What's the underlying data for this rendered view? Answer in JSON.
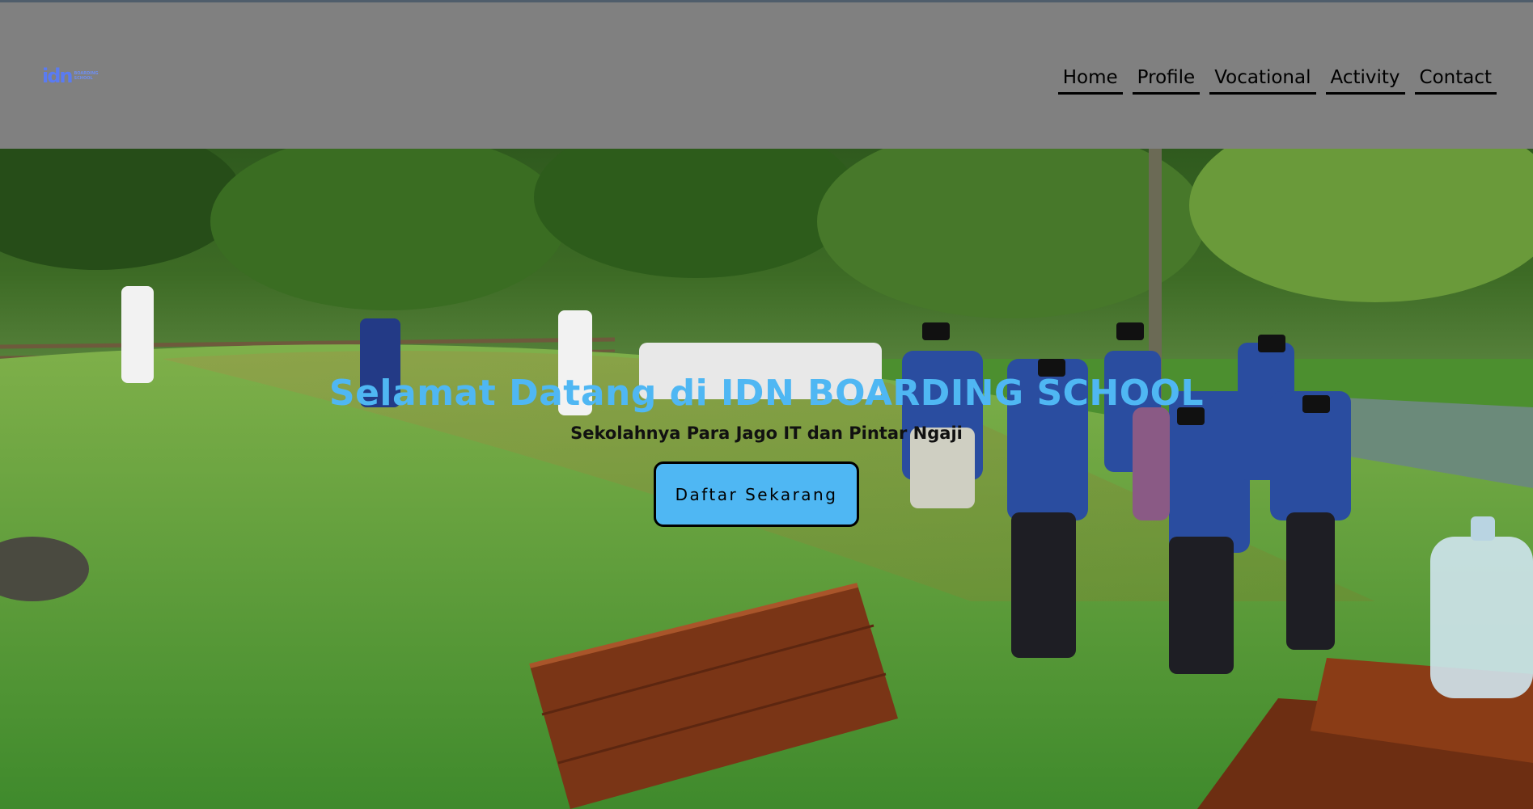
{
  "logo": {
    "mark": "idn",
    "sub_line1": "BOARDING",
    "sub_line2": "SCHOOL",
    "color": "#5a7bf2"
  },
  "nav": {
    "items": [
      {
        "label": "Home"
      },
      {
        "label": "Profile"
      },
      {
        "label": "Vocational"
      },
      {
        "label": "Activity"
      },
      {
        "label": "Contact"
      }
    ]
  },
  "hero": {
    "title": "Selamat Datang di IDN BOARDING SCHOOL",
    "subtitle": "Sekolahnya Para Jago IT dan Pintar Ngaji",
    "cta_label": "Daftar Sekarang",
    "accent_color": "#4fb7f3",
    "background_image": "students-outdoor-assembly-photo"
  }
}
